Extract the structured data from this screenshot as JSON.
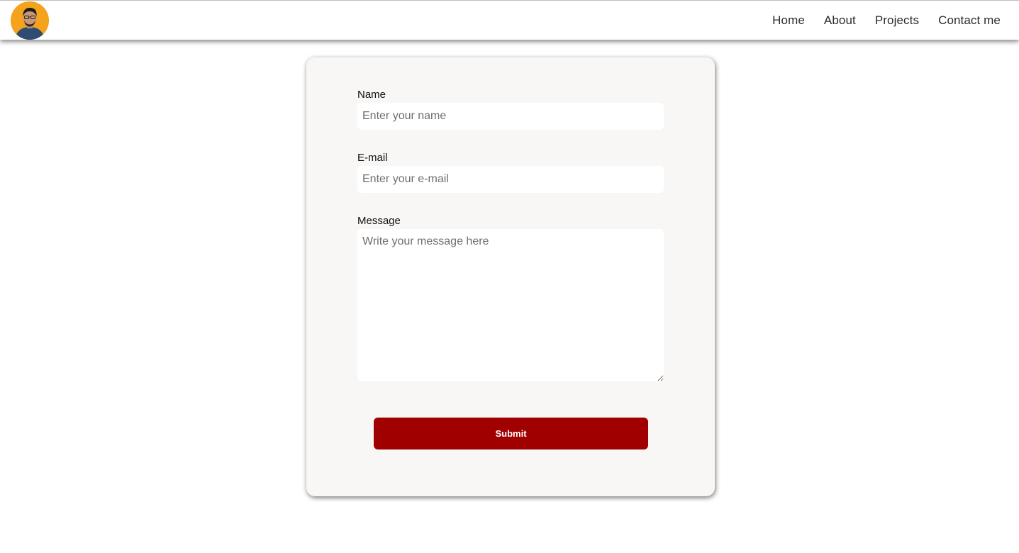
{
  "nav": {
    "links": [
      "Home",
      "About",
      "Projects",
      "Contact me"
    ]
  },
  "form": {
    "name": {
      "label": "Name",
      "placeholder": "Enter your name",
      "value": ""
    },
    "email": {
      "label": "E-mail",
      "placeholder": "Enter your e-mail",
      "value": ""
    },
    "message": {
      "label": "Message",
      "placeholder": "Write your message here",
      "value": ""
    },
    "submit_label": "Submit"
  },
  "colors": {
    "accent": "#a00000",
    "avatar_ring": "#f5a21c",
    "card_background": "#f8f7f5"
  },
  "icons": {
    "avatar": "profile-photo-avatar"
  }
}
